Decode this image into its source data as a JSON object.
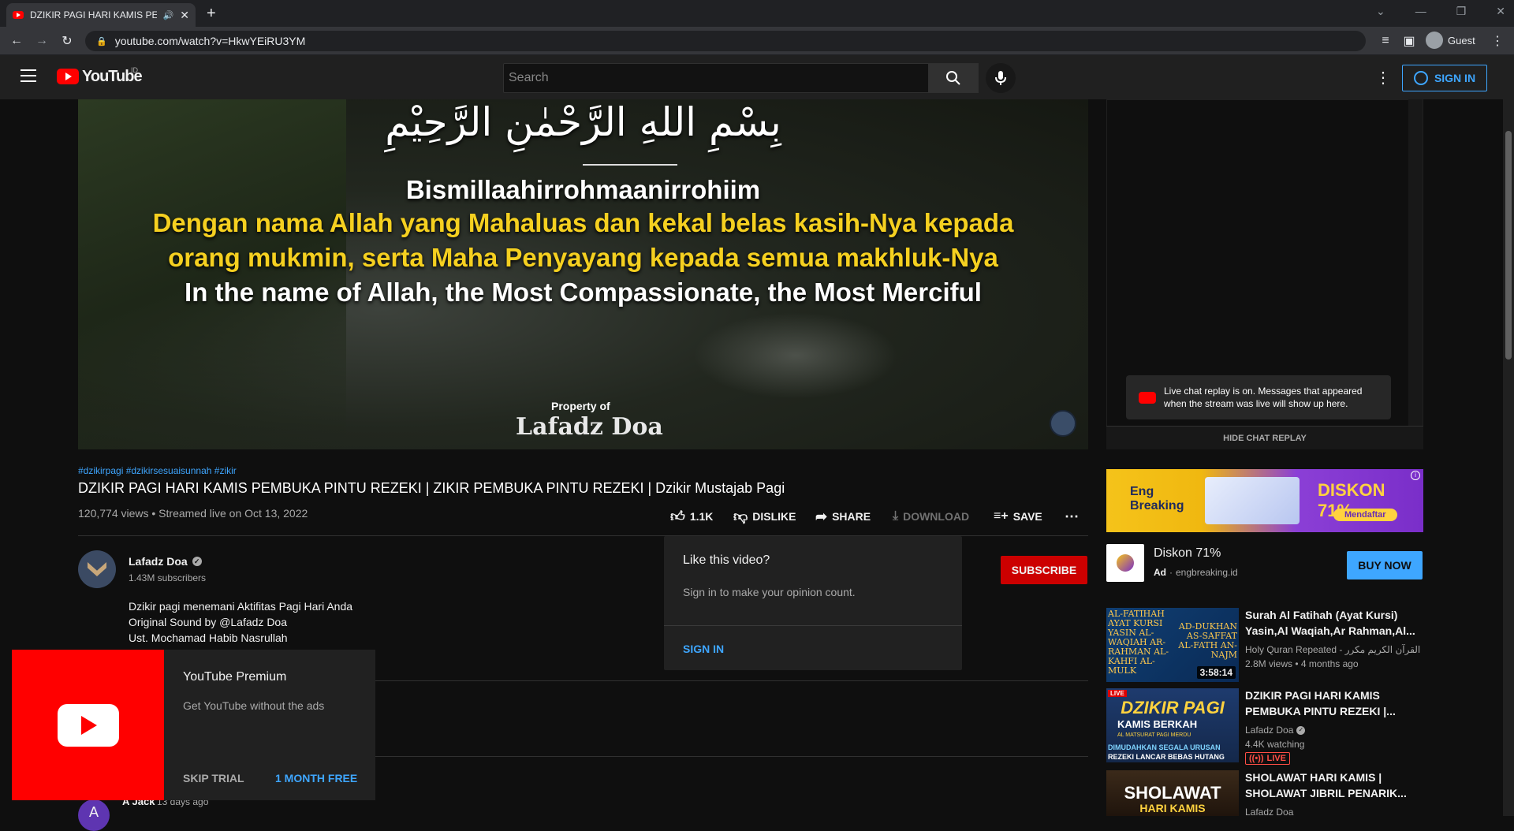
{
  "browser": {
    "tab_title": "DZIKIR PAGI HARI KAMIS PEMBUKA PINTU REZEKI",
    "url": "youtube.com/watch?v=HkwYEiRU3YM",
    "profile": "Guest"
  },
  "header": {
    "logo_text": "YouTube",
    "region": "ID",
    "search_placeholder": "Search",
    "sign_in": "SIGN IN"
  },
  "video": {
    "arabic": "بِسْمِ اللهِ الرَّحْمٰنِ الرَّحِيْمِ",
    "transliteration": "Bismillaahirrohmaanirrohiim",
    "indonesian_line1": "Dengan nama Allah yang Mahaluas dan kekal belas kasih-Nya kepada",
    "indonesian_line2": "orang mukmin, serta Maha Penyayang kepada semua makhluk-Nya",
    "english": "In the name of Allah, the Most Compassionate, the Most Merciful",
    "watermark_small": "Property of",
    "watermark_big": "Lafadz Doa"
  },
  "chat": {
    "notice": "Live chat replay is on. Messages that appeared when the stream was live will show up here.",
    "hide_button": "HIDE CHAT REPLAY"
  },
  "info": {
    "hashtags": "#dzikirpagi #dzikirsesuaisunnah #zikir",
    "title": "DZIKIR PAGI HARI KAMIS PEMBUKA PINTU REZEKI | ZIKIR PEMBUKA PINTU REZEKI | Dzikir Mustajab Pagi",
    "stats": "120,774 views • Streamed live on Oct 13, 2022",
    "like_count": "1.1K",
    "dislike": "DISLIKE",
    "share": "SHARE",
    "download": "DOWNLOAD",
    "save": "SAVE"
  },
  "channel": {
    "name": "Lafadz Doa",
    "subscribers": "1.43M subscribers",
    "subscribe": "SUBSCRIBE",
    "desc1": "Dzikir pagi menemani Aktifitas Pagi Hari Anda",
    "desc2": "Original Sound by @Lafadz Doa",
    "desc3": "Ust. Mochamad Habib Nasrullah"
  },
  "like_popup": {
    "title": "Like this video?",
    "body": "Sign in to make your opinion count.",
    "action": "SIGN IN"
  },
  "premium": {
    "title": "YouTube Premium",
    "body": "Get YouTube without the ads",
    "skip": "SKIP TRIAL",
    "free": "1 MONTH FREE"
  },
  "comment": {
    "author": "A Jack",
    "time": "13 days ago",
    "initial": "A"
  },
  "ad": {
    "banner_brand": "Eng Breaking",
    "banner_discount": "DISKON 71%",
    "banner_cta": "Mendaftar",
    "title": "Diskon 71%",
    "badge": "Ad",
    "domain": "engbreaking.id",
    "buy": "BUY NOW"
  },
  "recommendations": [
    {
      "title": "Surah Al Fatihah (Ayat Kursi) Yasin,Al Waqiah,Ar Rahman,Al...",
      "channel": "Holy Quran Repeated - القرآن الكريم مكرر",
      "meta": "2.8M views • 4 months ago",
      "duration": "3:58:14",
      "thumb_left": "AL-FATIHAH AYAT KURSI YASIN AL-WAQIAH AR-RAHMAN AL-KAHFI AL-MULK",
      "thumb_right": "AD-DUKHAN AS-SAFFAT AL-FATH AN-NAJM"
    },
    {
      "title": "DZIKIR PAGI HARI KAMIS PEMBUKA PINTU REZEKI |...",
      "channel": "Lafadz Doa",
      "meta": "4.4K watching",
      "live": "LIVE",
      "thumb_line1": "DZIKIR PAGI",
      "thumb_line2": "KAMIS BERKAH",
      "thumb_line3": "AL MATSURAT PAGI MERDU",
      "thumb_line4": "DIMUDAHKAN SEGALA URUSAN",
      "thumb_line5": "REZEKI LANCAR BEBAS HUTANG"
    },
    {
      "title": "SHOLAWAT HARI KAMIS | SHOLAWAT JIBRIL PENARIK...",
      "channel": "Lafadz Doa",
      "thumb_line1": "SHOLAWAT",
      "thumb_line2": "HARI KAMIS"
    }
  ]
}
